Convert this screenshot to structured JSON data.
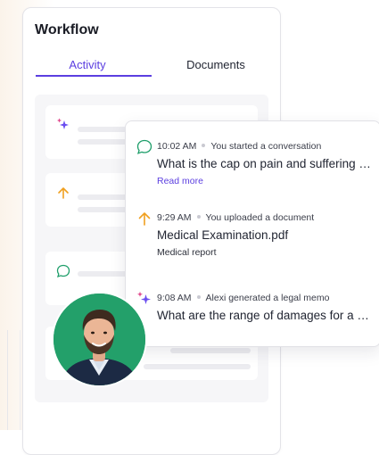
{
  "panel": {
    "title": "Workflow",
    "tabs": [
      {
        "label": "Activity",
        "active": true
      },
      {
        "label": "Documents",
        "active": false
      }
    ]
  },
  "activity": [
    {
      "icon": "chat-bubble-icon",
      "time": "10:02 AM",
      "action": "You started a conversation",
      "headline": "What is the cap on pain and suffering in...",
      "sub": "Read more",
      "sub_is_link": true
    },
    {
      "icon": "arrow-up-icon",
      "time": "9:29 AM",
      "action": "You uploaded a document",
      "headline": "Medical Examination.pdf",
      "sub": "Medical report",
      "sub_is_link": false
    },
    {
      "icon": "sparkle-icon",
      "time": "9:08 AM",
      "action": "Alexi generated a legal memo",
      "headline": "What are the range of damages for a b...",
      "sub": "",
      "sub_is_link": false
    }
  ],
  "colors": {
    "accent": "#5b3ee0",
    "chat_green": "#1e9e6a",
    "upload_orange": "#f0a020",
    "avatar_bg": "#23a06a"
  }
}
